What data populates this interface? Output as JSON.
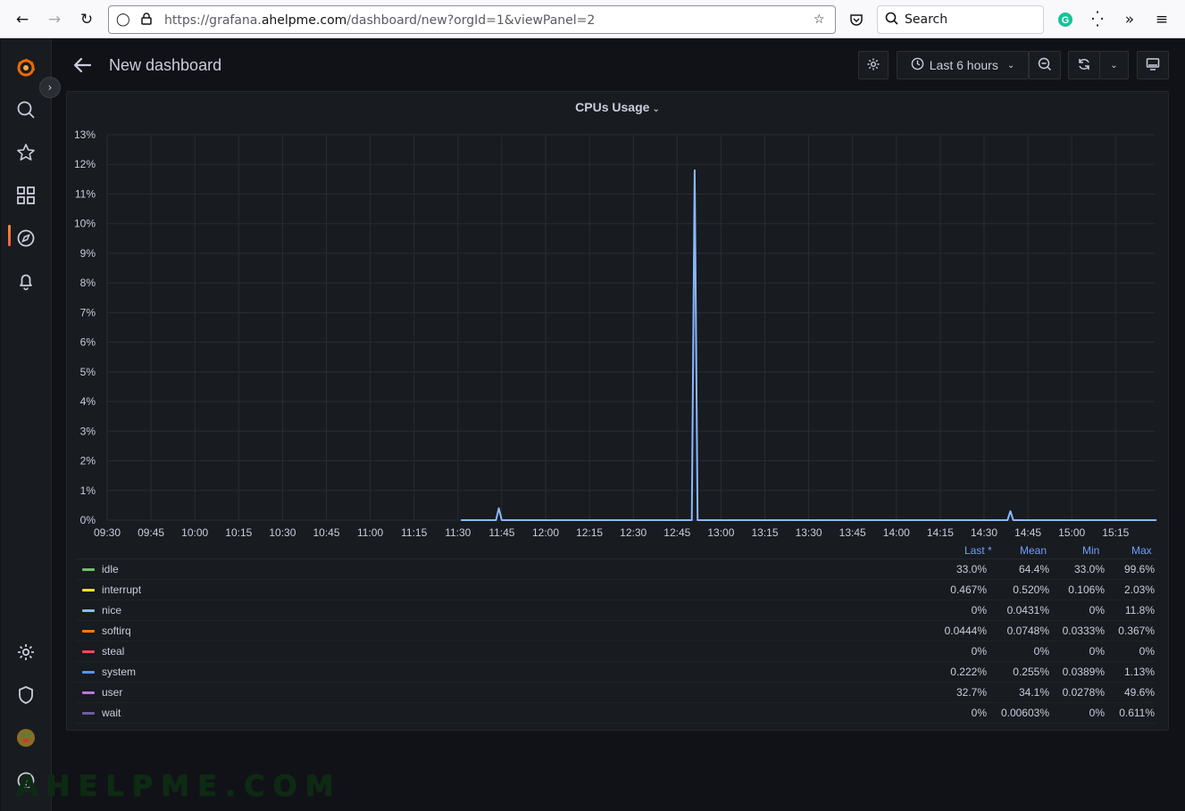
{
  "browser": {
    "url_prefix": "https://grafana.",
    "url_domain": "ahelpme.com",
    "url_path": "/dashboard/new?orgId=1&viewPanel=2",
    "search_placeholder": "Search"
  },
  "header": {
    "title": "New dashboard",
    "time_range": "Last 6 hours"
  },
  "panel": {
    "title": "CPUs Usage"
  },
  "legend": {
    "headers": {
      "last": "Last *",
      "mean": "Mean",
      "min": "Min",
      "max": "Max"
    },
    "rows": [
      {
        "name": "idle",
        "color": "#73bf69",
        "last": "33.0%",
        "mean": "64.4%",
        "min": "33.0%",
        "max": "99.6%"
      },
      {
        "name": "interrupt",
        "color": "#fade2a",
        "last": "0.467%",
        "mean": "0.520%",
        "min": "0.106%",
        "max": "2.03%"
      },
      {
        "name": "nice",
        "color": "#8ab8ff",
        "last": "0%",
        "mean": "0.0431%",
        "min": "0%",
        "max": "11.8%"
      },
      {
        "name": "softirq",
        "color": "#ff780a",
        "last": "0.0444%",
        "mean": "0.0748%",
        "min": "0.0333%",
        "max": "0.367%"
      },
      {
        "name": "steal",
        "color": "#f2495c",
        "last": "0%",
        "mean": "0%",
        "min": "0%",
        "max": "0%"
      },
      {
        "name": "system",
        "color": "#5794f2",
        "last": "0.222%",
        "mean": "0.255%",
        "min": "0.0389%",
        "max": "1.13%"
      },
      {
        "name": "user",
        "color": "#b877d9",
        "last": "32.7%",
        "mean": "34.1%",
        "min": "0.0278%",
        "max": "49.6%"
      },
      {
        "name": "wait",
        "color": "#705da0",
        "last": "0%",
        "mean": "0.00603%",
        "min": "0%",
        "max": "0.611%"
      }
    ]
  },
  "chart_data": {
    "type": "line",
    "title": "CPUs Usage",
    "ylim": [
      0,
      13
    ],
    "y_ticks": [
      "0%",
      "1%",
      "2%",
      "3%",
      "4%",
      "5%",
      "6%",
      "7%",
      "8%",
      "9%",
      "10%",
      "11%",
      "12%",
      "13%"
    ],
    "x_ticks": [
      "09:30",
      "09:45",
      "10:00",
      "10:15",
      "10:30",
      "10:45",
      "11:00",
      "11:15",
      "11:30",
      "11:45",
      "12:00",
      "12:15",
      "12:30",
      "12:45",
      "13:00",
      "13:15",
      "13:30",
      "13:45",
      "14:00",
      "14:15",
      "14:30",
      "14:45",
      "15:00",
      "15:15"
    ],
    "grid": true,
    "series": [
      {
        "name": "nice",
        "color": "#8ab8ff",
        "points": [
          [
            "11:31",
            0
          ],
          [
            "11:43",
            0
          ],
          [
            "11:44",
            0.4
          ],
          [
            "11:45",
            0
          ],
          [
            "12:50",
            0
          ],
          [
            "12:51",
            11.8
          ],
          [
            "12:52",
            0
          ],
          [
            "14:38",
            0
          ],
          [
            "14:39",
            0.3
          ],
          [
            "14:40",
            0
          ],
          [
            "15:29",
            0
          ]
        ]
      }
    ],
    "watermark": "AHELPME.COM"
  }
}
